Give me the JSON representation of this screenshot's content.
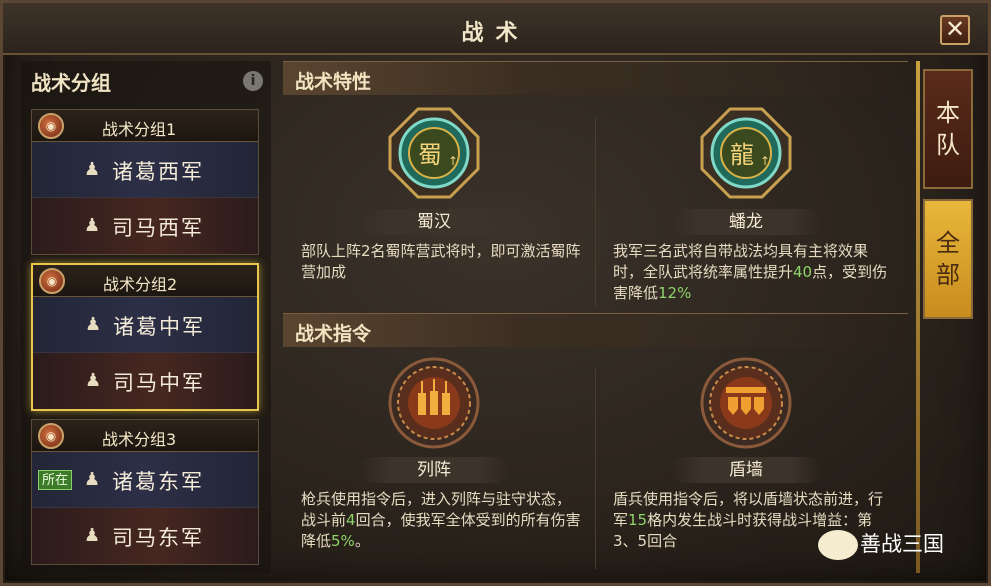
{
  "window": {
    "title": "战术",
    "close_label": "✕"
  },
  "left": {
    "header": "战术分组",
    "info_icon": "i",
    "groups": [
      {
        "name": "战术分组1",
        "armies": [
          "诸葛西军",
          "司马西军"
        ]
      },
      {
        "name": "战术分组2",
        "armies": [
          "诸葛中军",
          "司马中军"
        ],
        "selected": true
      },
      {
        "name": "战术分组3",
        "armies": [
          "诸葛东军",
          "司马东军"
        ],
        "tag": "所在"
      }
    ]
  },
  "traits": {
    "header": "战术特性",
    "items": [
      {
        "name": "蜀汉",
        "emblem_char": "蜀",
        "desc": "部队上阵2名蜀阵营武将时，即可激活蜀阵营加成"
      },
      {
        "name": "蟠龙",
        "emblem_char": "龍",
        "desc_parts": [
          "我军三名武将自带战法均具有主将效果时，全队武将统率属性提升",
          "40",
          "点，受到伤害降低",
          "12%"
        ]
      }
    ]
  },
  "orders": {
    "header": "战术指令",
    "items": [
      {
        "name": "列阵",
        "desc_parts": [
          "枪兵使用指令后，进入列阵与驻守状态，战斗前",
          "4",
          "回合，使我军全体受到的所有伤害降低",
          "5%",
          "。"
        ]
      },
      {
        "name": "盾墙",
        "desc_parts": [
          "盾兵使用指令后，将以盾墙状态前进，行军",
          "15",
          "格内发生战斗时获得战斗增益：第3、5回合"
        ]
      }
    ]
  },
  "tabs": {
    "active": "本队",
    "inactive": "全部"
  },
  "watermark": "善战三国",
  "colors": {
    "highlight": "#8fd36a",
    "selected_border": "#e8c64a",
    "tab_active": "#5a2b1a",
    "tab_inactive": "#e8b73a"
  }
}
